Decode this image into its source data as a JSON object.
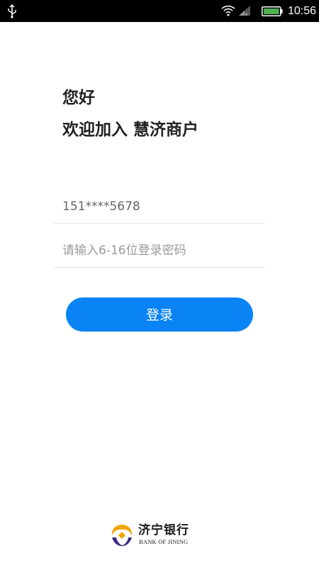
{
  "status_bar": {
    "time": "10:56",
    "icons": [
      "usb-icon",
      "wifi-icon",
      "signal-icon",
      "battery-icon"
    ]
  },
  "greeting": {
    "line1": "您好",
    "line2": "欢迎加入 慧济商户"
  },
  "login_form": {
    "phone_value": "151****5678",
    "password_placeholder": "请输入6-16位登录密码",
    "login_button_label": "登录"
  },
  "footer": {
    "bank_name_cn": "济宁银行",
    "bank_name_en": "BANK OF JINING"
  },
  "colors": {
    "accent": "#0a84f5",
    "status_bar_bg": "#000000",
    "text_primary": "#222222",
    "placeholder": "#9a9a9a",
    "logo_gold": "#f0a500",
    "logo_purple": "#3b2a84"
  }
}
